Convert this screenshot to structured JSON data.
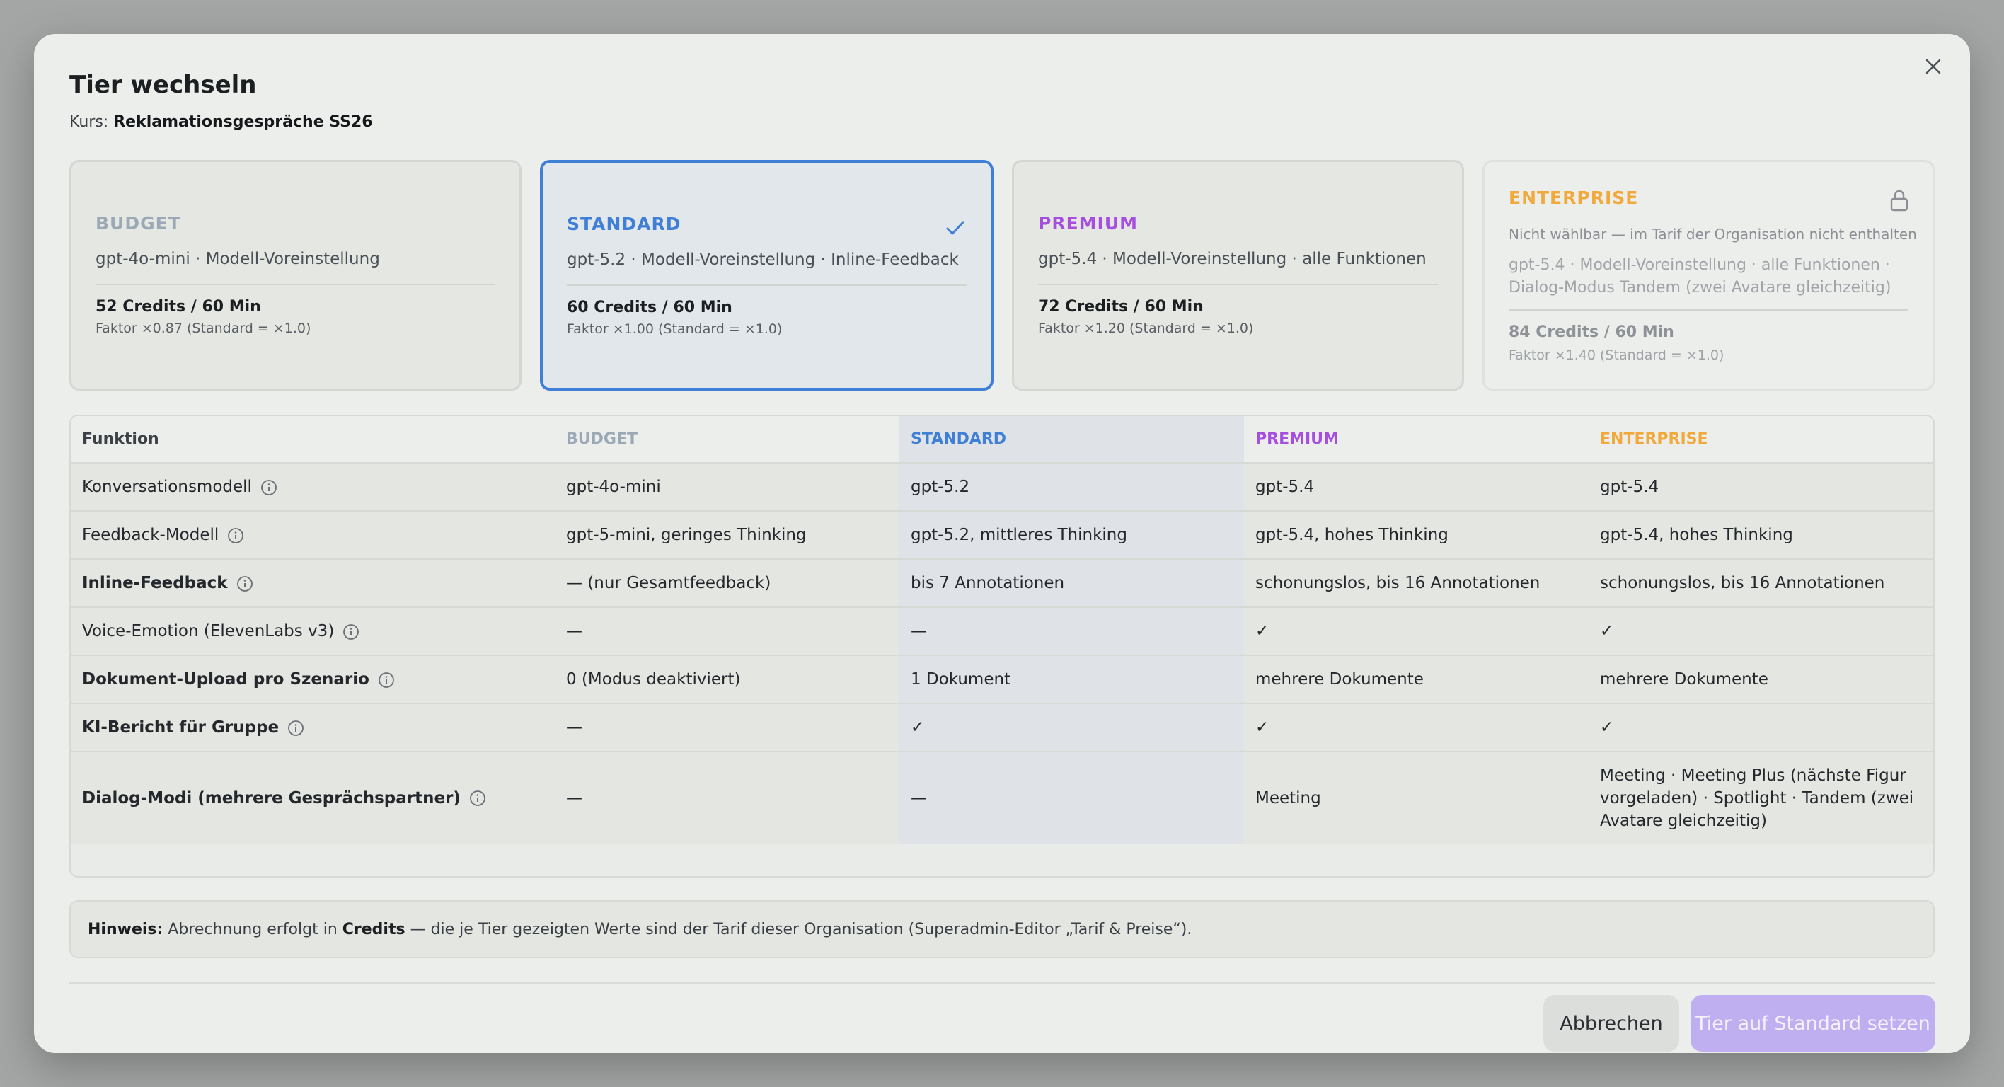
{
  "modal": {
    "title": "Tier wechseln",
    "course_label": "Kurs:",
    "course_name": "Reklamationsgespräche SS26"
  },
  "cards": [
    {
      "name": "BUDGET",
      "desc": "gpt-4o-mini · Modell-Voreinstellung",
      "credits": "52 Credits / 60 Min",
      "factor": "Faktor ×0.87 (Standard = ×1.0)",
      "color": "#9ba8b6"
    },
    {
      "name": "STANDARD",
      "desc": "gpt-5.2 · Modell-Voreinstellung · Inline-Feedback",
      "credits": "60 Credits / 60 Min",
      "factor": "Faktor ×1.00 (Standard = ×1.0)",
      "color": "#3f7fd6",
      "selected": true
    },
    {
      "name": "PREMIUM",
      "desc": "gpt-5.4 · Modell-Voreinstellung · alle Funktionen",
      "credits": "72 Credits / 60 Min",
      "factor": "Faktor ×1.20 (Standard = ×1.0)",
      "color": "#a64fdf"
    },
    {
      "name": "ENTERPRISE",
      "note": "Nicht wählbar — im Tarif der Organisation nicht enthalten",
      "desc": "gpt-5.4 · Modell-Voreinstellung · alle Funktionen · Dialog-Modus Tandem (zwei Avatare gleichzeitig)",
      "credits": "84 Credits / 60 Min",
      "factor": "Faktor ×1.40 (Standard = ×1.0)",
      "color": "#f0a93a",
      "disabled": true
    }
  ],
  "table": {
    "headers": [
      "Funktion",
      "BUDGET",
      "STANDARD",
      "PREMIUM",
      "ENTERPRISE"
    ],
    "rows": [
      {
        "label": "Konversationsmodell",
        "bold": false,
        "cells": [
          "gpt-4o-mini",
          "gpt-5.2",
          "gpt-5.4",
          "gpt-5.4"
        ]
      },
      {
        "label": "Feedback-Modell",
        "bold": false,
        "cells": [
          "gpt-5-mini, geringes Thinking",
          "gpt-5.2, mittleres Thinking",
          "gpt-5.4, hohes Thinking",
          "gpt-5.4, hohes Thinking"
        ]
      },
      {
        "label": "Inline-Feedback",
        "bold": true,
        "cells": [
          "— (nur Gesamtfeedback)",
          "bis 7 Annotationen",
          "schonungslos, bis 16 Annotationen",
          "schonungslos, bis 16 Annotationen"
        ]
      },
      {
        "label": "Voice-Emotion (ElevenLabs v3)",
        "bold": false,
        "cells": [
          "—",
          "—",
          "✓",
          "✓"
        ]
      },
      {
        "label": "Dokument-Upload pro Szenario",
        "bold": true,
        "cells": [
          "0 (Modus deaktiviert)",
          "1 Dokument",
          "mehrere Dokumente",
          "mehrere Dokumente"
        ]
      },
      {
        "label": "KI-Bericht für Gruppe",
        "bold": true,
        "cells": [
          "—",
          "✓",
          "✓",
          "✓"
        ]
      },
      {
        "label": "Dialog-Modi (mehrere Gesprächspartner)",
        "bold": true,
        "cells": [
          "—",
          "—",
          "Meeting",
          "Meeting · Meeting Plus (nächste Figur vorgeladen) · Spotlight · Tandem (zwei Avatare gleichzeitig)"
        ]
      }
    ]
  },
  "hint": {
    "prefix": "Hinweis:",
    "text1": " Abrechnung erfolgt in ",
    "credits": "Credits",
    "text2": " — die je Tier gezeigten Werte sind der Tarif dieser Organisation (Superadmin-Editor „Tarif & Preise“)."
  },
  "footer": {
    "cancel_label": "Abbrechen",
    "confirm_label": "Tier auf Standard setzen"
  },
  "icons": {
    "close": "close-icon",
    "check": "check-icon",
    "lock": "lock-icon",
    "info": "info-icon"
  }
}
